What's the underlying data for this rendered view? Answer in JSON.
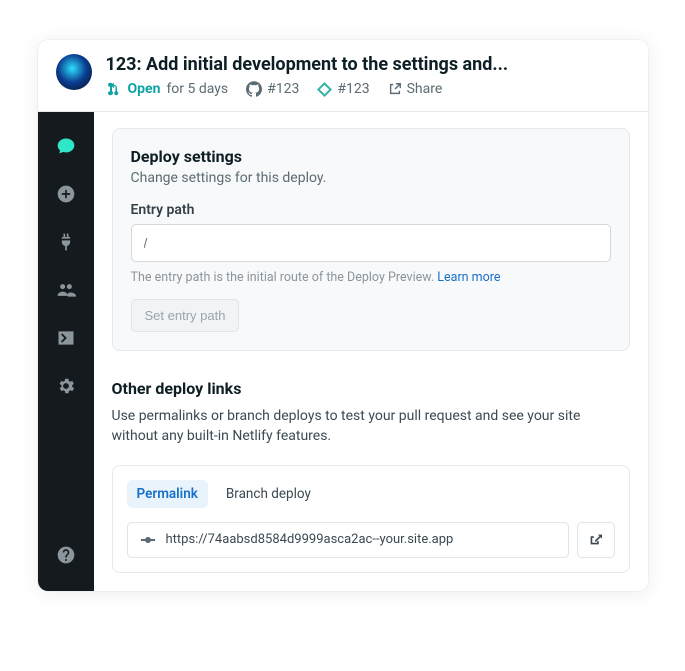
{
  "header": {
    "title": "123: Add initial development to the settings and...",
    "status_label": "Open",
    "status_duration": "for 5 days",
    "github_ref": "#123",
    "netlify_ref": "#123",
    "share_label": "Share"
  },
  "deploy_settings": {
    "heading": "Deploy settings",
    "description": "Change settings for this deploy.",
    "field_label": "Entry path",
    "input_value": "/",
    "help_text": "The entry path is the initial route of the Deploy Preview. ",
    "learn_more": "Learn more",
    "button_label": "Set entry path"
  },
  "other_links": {
    "heading": "Other deploy links",
    "description": "Use permalinks or branch deploys to test your pull request and see your site without any built-in Netlify features.",
    "tabs": {
      "permalink": "Permalink",
      "branch": "Branch deploy"
    },
    "url": "https://74aabsd8584d9999asca2ac--your.site.app"
  }
}
